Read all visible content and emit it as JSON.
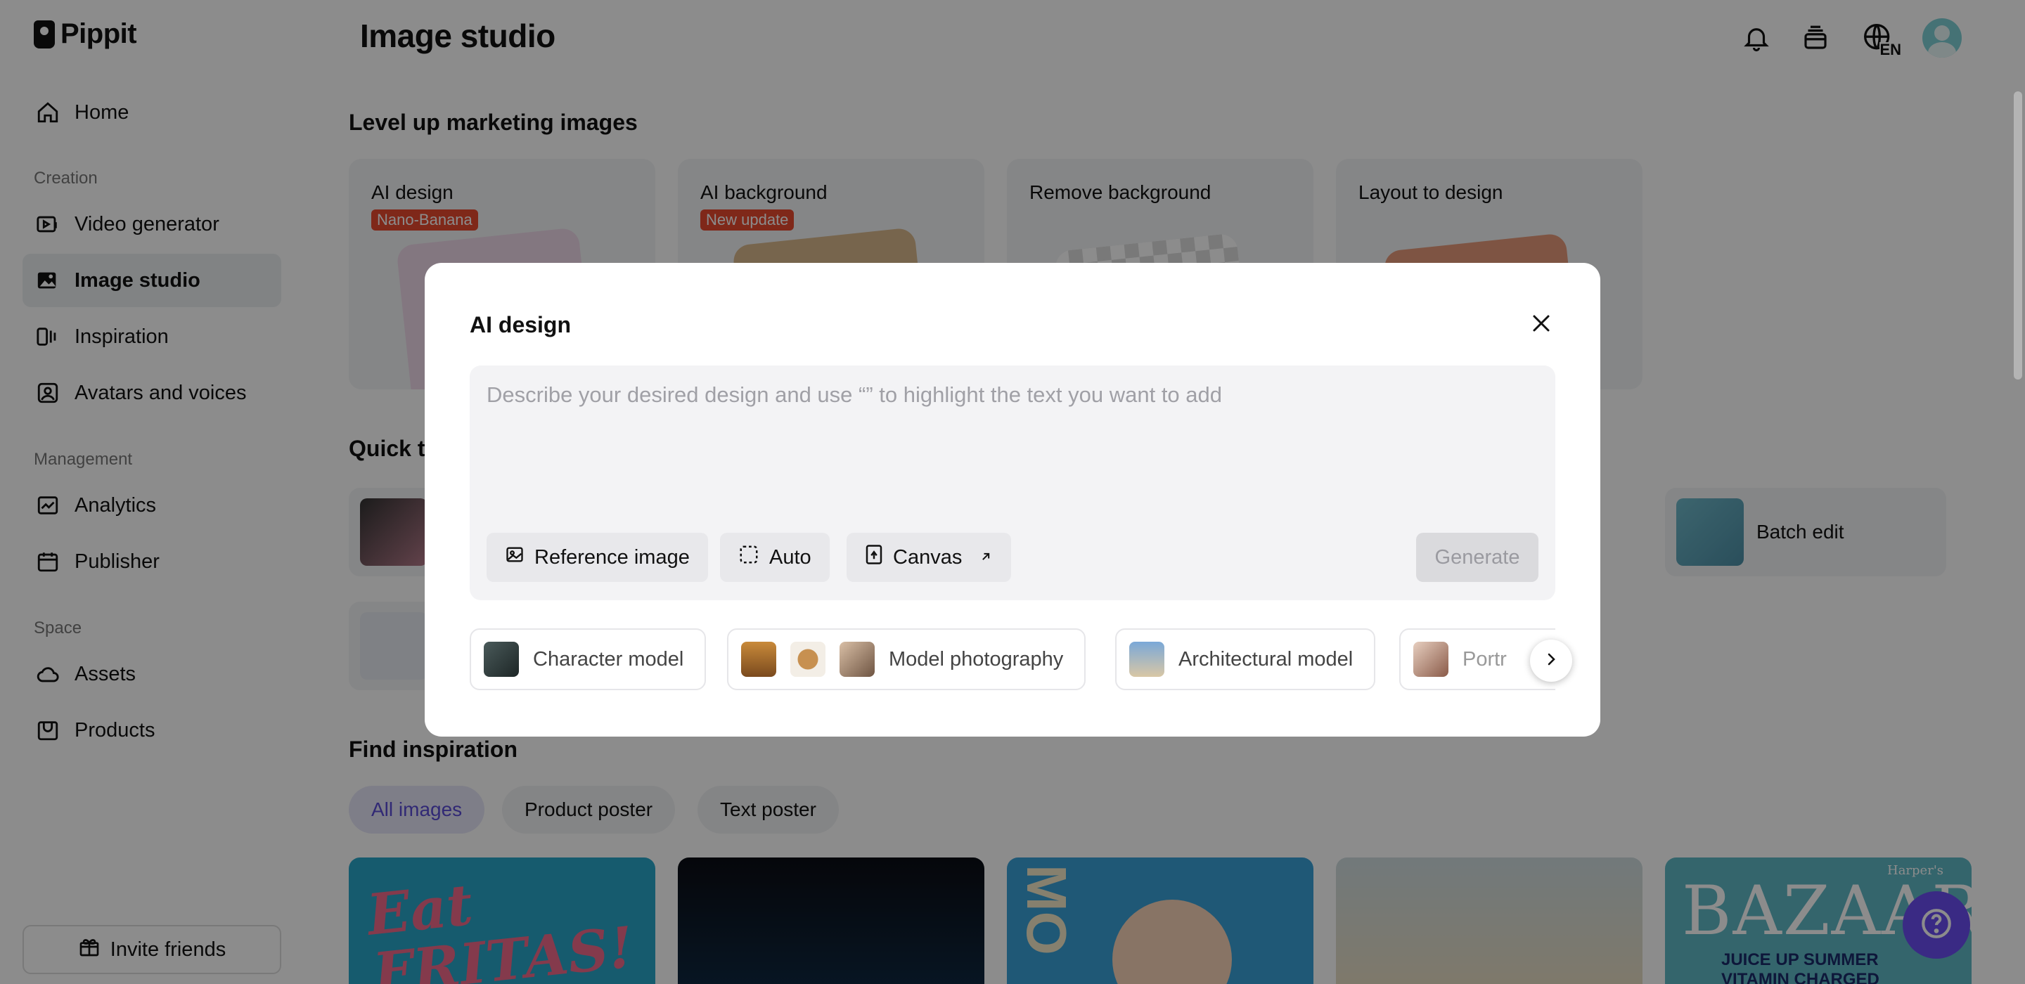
{
  "app": {
    "brand": "Pippit"
  },
  "sidebar": {
    "home": "Home",
    "creation_label": "Creation",
    "creation": [
      {
        "label": "Video generator",
        "icon": "video-generator-icon"
      },
      {
        "label": "Image studio",
        "icon": "image-studio-icon",
        "active": true
      },
      {
        "label": "Inspiration",
        "icon": "inspiration-icon"
      },
      {
        "label": "Avatars and voices",
        "icon": "avatar-icon"
      }
    ],
    "management_label": "Management",
    "management": [
      {
        "label": "Analytics",
        "icon": "analytics-icon"
      },
      {
        "label": "Publisher",
        "icon": "calendar-icon"
      }
    ],
    "space_label": "Space",
    "space": [
      {
        "label": "Assets",
        "icon": "cloud-icon"
      },
      {
        "label": "Products",
        "icon": "product-box-icon"
      }
    ],
    "invite": "Invite friends"
  },
  "header": {
    "title": "Image studio",
    "language": "EN",
    "icons": [
      "bell-icon",
      "stack-icon",
      "globe-icon",
      "avatar"
    ]
  },
  "main": {
    "level_up_title": "Level up marketing images",
    "feature_cards": [
      {
        "title": "AI design",
        "badge": "Nano-Banana"
      },
      {
        "title": "AI background",
        "badge": "New update"
      },
      {
        "title": "Remove background",
        "badge": ""
      },
      {
        "title": "Layout to design",
        "badge": ""
      }
    ],
    "quick_tools_title": "Quick t",
    "batch_edit": "Batch edit",
    "find_inspiration_title": "Find inspiration",
    "filters": [
      "All images",
      "Product poster",
      "Text poster"
    ],
    "inspiration_text": {
      "card1": "Eat FRITAS!",
      "card5": "BAZAAR",
      "card5_sub": "JUICE UP SUMMER",
      "card5_sub2": "VITAMIN CHARGED",
      "card5_top": "Harper's",
      "card3": "MO"
    }
  },
  "modal": {
    "title": "AI design",
    "prompt_value": "",
    "prompt_placeholder": "Describe your desired design and use “” to highlight the text you want to add",
    "tools": {
      "reference_image": "Reference image",
      "auto": "Auto",
      "canvas": "Canvas"
    },
    "generate": "Generate",
    "templates": [
      "Character model",
      "Model photography",
      "Architectural model",
      "Portr"
    ]
  },
  "colors": {
    "accent": "#6a4ef0",
    "badge_red": "#e84a2f",
    "active_chip_text": "#5a4bd6",
    "overlay": "rgba(0,0,0,0.45)"
  }
}
